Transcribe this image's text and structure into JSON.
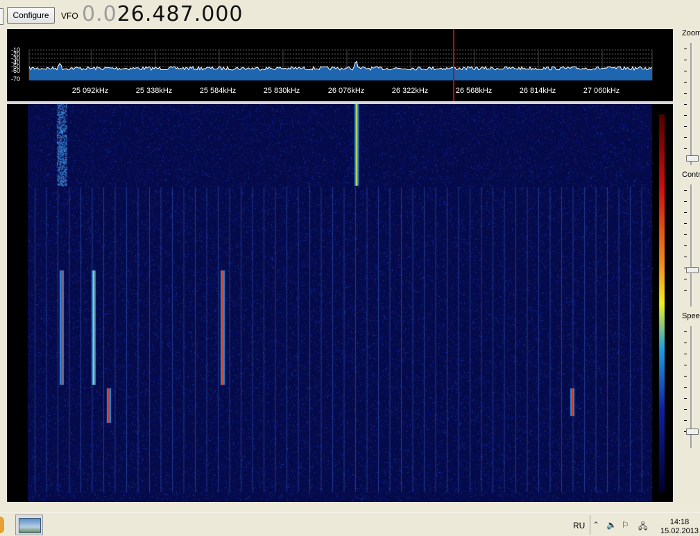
{
  "toolbar": {
    "configure_label": "Configure",
    "vfo_label": "VFO",
    "freq_dim": "0.0",
    "freq_main": "26.487.000"
  },
  "spectrum": {
    "db_labels": [
      "-10",
      "-20",
      "-30",
      "-40",
      "-50",
      "-60",
      "-70"
    ],
    "freq_labels": [
      "25 092kHz",
      "25 338kHz",
      "25 584kHz",
      "25 830kHz",
      "26 076kHz",
      "26 322kHz",
      "26 568kHz",
      "26 814kHz",
      "27 060kHz"
    ],
    "trace_color": "#ffffff",
    "fill_color": "#1f66b0",
    "marker_color": "#b01010"
  },
  "sliders": {
    "zoom_label": "Zoom",
    "contrast_label": "Contra",
    "speed_label": "Spee"
  },
  "taskbar": {
    "language": "RU",
    "time": "14:18",
    "date": "15.02.2013"
  }
}
